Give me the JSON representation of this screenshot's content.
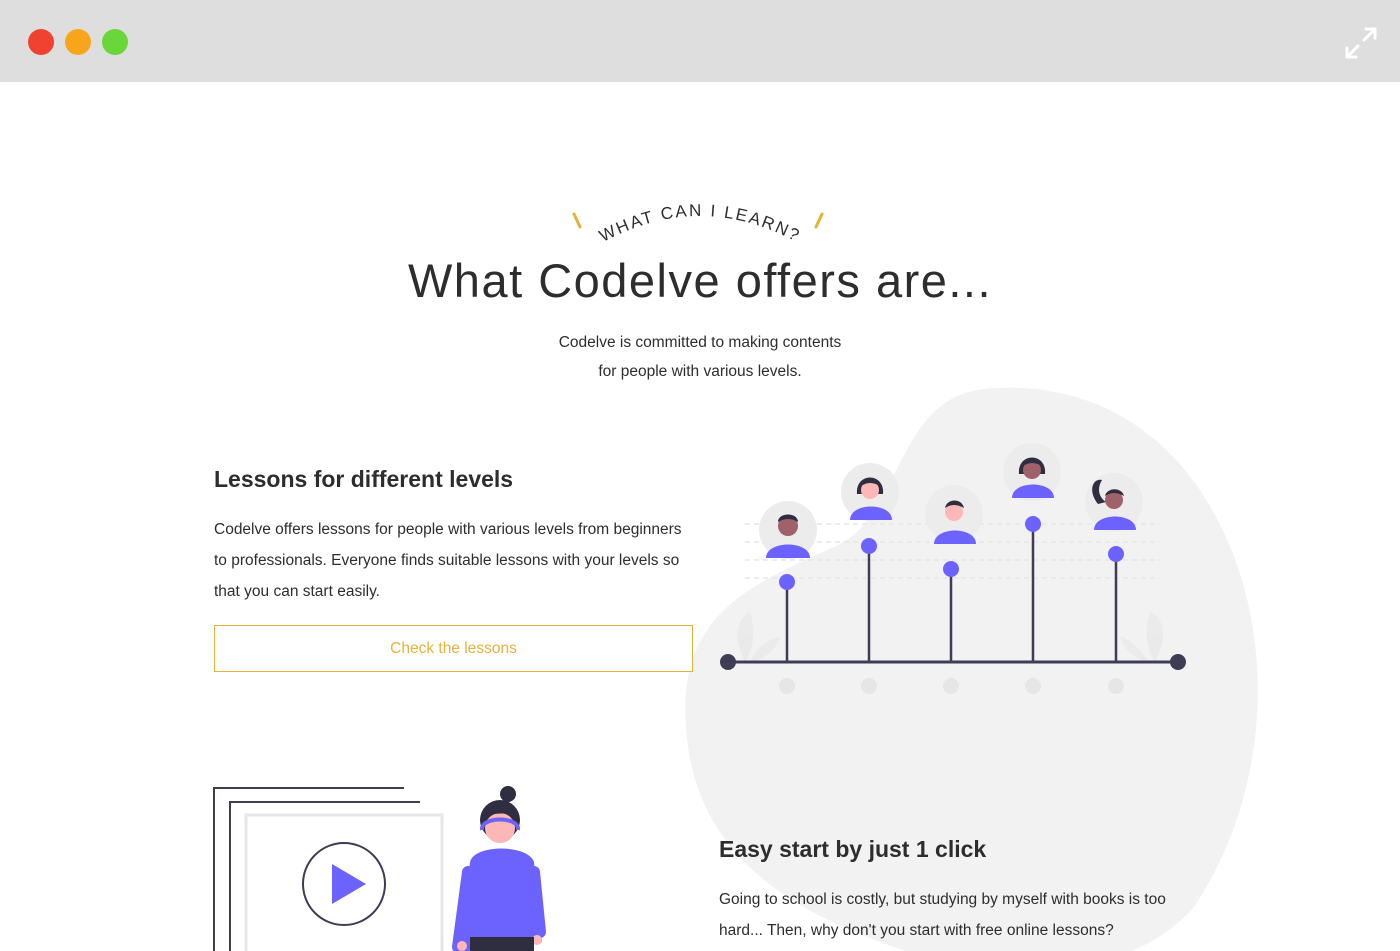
{
  "window": {
    "controls": [
      "close-dot",
      "minimize-dot",
      "maximize-dot"
    ],
    "expand_icon": "expand-arrows-icon"
  },
  "section": {
    "eyebrow": "WHAT CAN I LEARN?",
    "title": "What Codelve offers are...",
    "intro_line1": "Codelve is committed to making contents",
    "intro_line2": "for people with various levels."
  },
  "features": [
    {
      "title": "Lessons for different levels",
      "body": "Codelve offers lessons for people with various levels from beginners to professionals. Everyone finds suitable lessons with your levels so that you can start easily.",
      "button_label": "Check the lessons",
      "illustration": "level-chart-people-illustration"
    },
    {
      "title": "Easy start by just 1 click",
      "body": "Going to school is costly, but studying by myself with books is too hard... Then, why don't you start with free online lessons?",
      "illustration": "video-player-person-illustration"
    }
  ],
  "colors": {
    "accent": "#e3b33b",
    "purple": "#6c63ff",
    "dark": "#2f2e41",
    "blob": "#f2f2f2"
  }
}
